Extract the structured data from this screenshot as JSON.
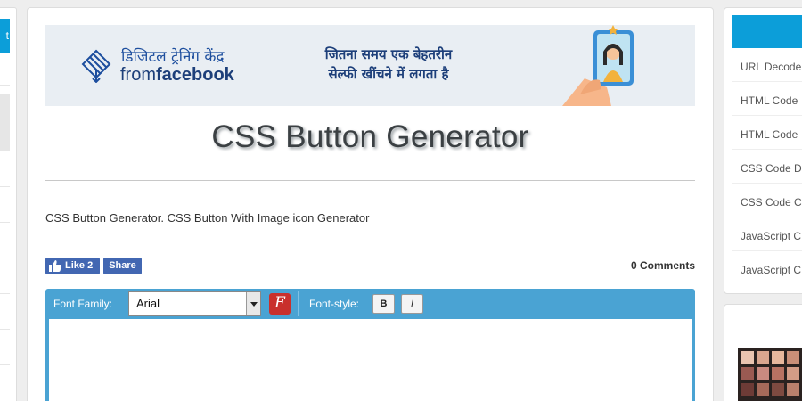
{
  "left_sidebar": {
    "tab_label": "t"
  },
  "ad": {
    "hindi_program": "डिजिटल ट्रेनिंग केंद्र",
    "from_prefix": "from",
    "brand": "facebook",
    "tagline_line1": "जितना समय एक बेहतरीन",
    "tagline_line2": "सेल्फी खींचने में लगता है"
  },
  "page": {
    "title": "CSS Button Generator",
    "description": "CSS Button Generator. CSS Button With Image icon Generator"
  },
  "social": {
    "like_label": "Like 2",
    "share_label": "Share",
    "comments": "0 Comments"
  },
  "editor": {
    "font_family_label": "Font Family:",
    "font_family_value": "Arial",
    "font_icon": "F",
    "font_style_label": "Font-style:",
    "bold_label": "B",
    "italic_label": "I"
  },
  "sidebar": {
    "links": [
      "URL Decode",
      "HTML Code",
      "HTML Code",
      "CSS Code D",
      "CSS Code C",
      "JavaScript C",
      "JavaScript C"
    ]
  },
  "colors": {
    "accent_blue": "#0c9ed9",
    "editor_blue": "#4aa3d3",
    "facebook_blue": "#4267b2",
    "font_icon_red": "#c9302c"
  }
}
